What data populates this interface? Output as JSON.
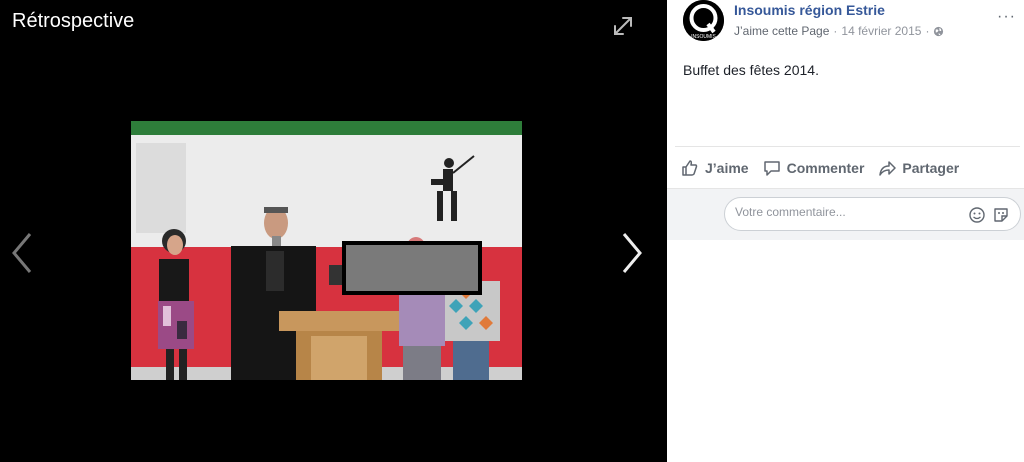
{
  "viewer": {
    "title": "Rétrospective",
    "icons": {
      "expand": "expand-icon",
      "prev": "chevron-left-icon",
      "next": "chevron-right-icon"
    }
  },
  "post": {
    "page_name": "Insoumis région Estrie",
    "like_page": "J’aime cette Page",
    "date": "14 février 2015",
    "separator": "·",
    "privacy_icon": "globe-icon",
    "more_label": "···",
    "text": "Buffet des fêtes 2014.",
    "avatar_text": "INSOUMIS"
  },
  "actions": {
    "like": "J’aime",
    "comment": "Commenter",
    "share": "Partager"
  },
  "comment_box": {
    "placeholder": "Votre commentaire..."
  },
  "colors": {
    "link": "#365899",
    "meta": "#616770",
    "viewer_bg": "#000000"
  }
}
